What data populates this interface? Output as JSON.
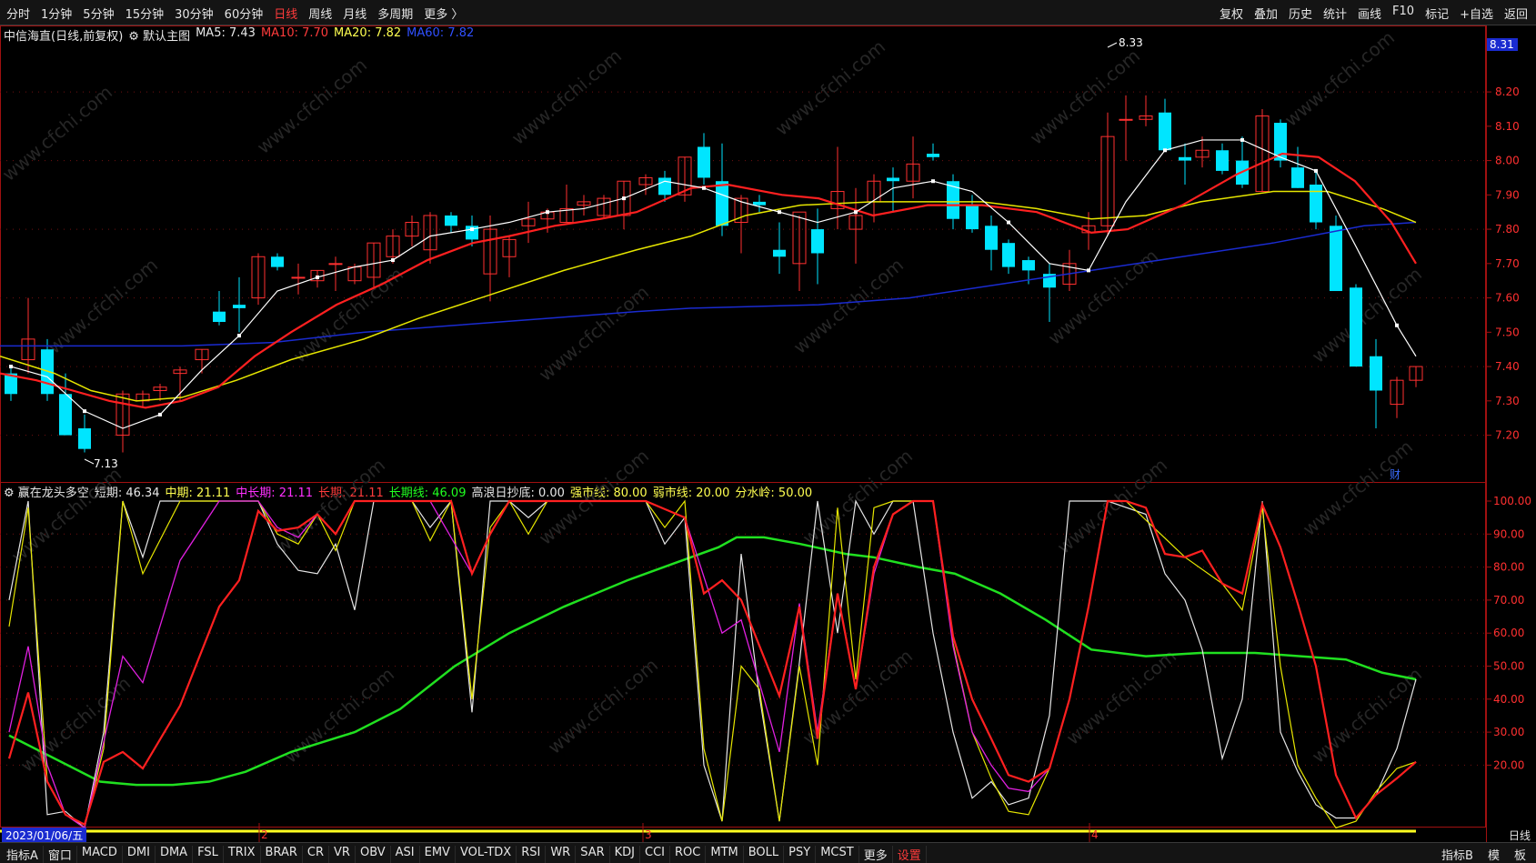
{
  "toolbar": {
    "left": [
      "分时",
      "1分钟",
      "5分钟",
      "15分钟",
      "30分钟",
      "60分钟",
      "日线",
      "周线",
      "月线",
      "多周期",
      "更多 〉"
    ],
    "active": "日线",
    "right": [
      "复权",
      "叠加",
      "历史",
      "统计",
      "画线",
      "F10",
      "标记",
      "+自选",
      "返回"
    ]
  },
  "main_legend": {
    "title": "中信海直(日线,前复权)",
    "template": "默认主图",
    "ma5": "MA5: 7.43",
    "ma10": "MA10: 7.70",
    "ma20": "MA20: 7.82",
    "ma60": "MA60: 7.82"
  },
  "price_tag": "8.31",
  "price_axis": [
    "8.20",
    "8.10",
    "8.00",
    "7.90",
    "7.80",
    "7.70",
    "7.60",
    "7.50",
    "7.40",
    "7.30",
    "7.20"
  ],
  "high_label": "8.33",
  "low_label": "7.13",
  "event_marker": "财",
  "indicator_legend": {
    "name": "赢在龙头多空",
    "short": "短期: 46.34",
    "mid": "中期: 21.11",
    "midlong": "中长期: 21.11",
    "long": "长期: 21.11",
    "longline": "长期线: 46.09",
    "gaolang": "高浪日抄底: 0.00",
    "strong": "强市线: 80.00",
    "weak": "弱市线: 20.00",
    "watershed": "分水岭: 50.00"
  },
  "ind_axis": [
    "100.00",
    "90.00",
    "80.00",
    "70.00",
    "60.00",
    "50.00",
    "40.00",
    "30.00",
    "20.00"
  ],
  "date_box": "2023/01/06/五",
  "month_marks": [
    "2",
    "3",
    "4"
  ],
  "period_box": "日线",
  "bottom_tabs": [
    "指标A",
    "窗口",
    "MACD",
    "DMI",
    "DMA",
    "FSL",
    "TRIX",
    "BRAR",
    "CR",
    "VR",
    "OBV",
    "ASI",
    "EMV",
    "VOL-TDX",
    "RSI",
    "WR",
    "SAR",
    "KDJ",
    "CCI",
    "ROC",
    "MTM",
    "BOLL",
    "PSY",
    "MCST",
    "更多",
    "设置"
  ],
  "bottom_right": [
    "指标B",
    "模",
    "板"
  ],
  "colors": {
    "up": "#ff3030",
    "down": "#00e5ff",
    "ma5": "#ffffff",
    "ma10": "#ff2020",
    "ma20": "#e6e600",
    "ma60": "#1a2bd0",
    "accent_red": "#ff3b3b"
  },
  "watermark": "www.cfchi.com"
}
